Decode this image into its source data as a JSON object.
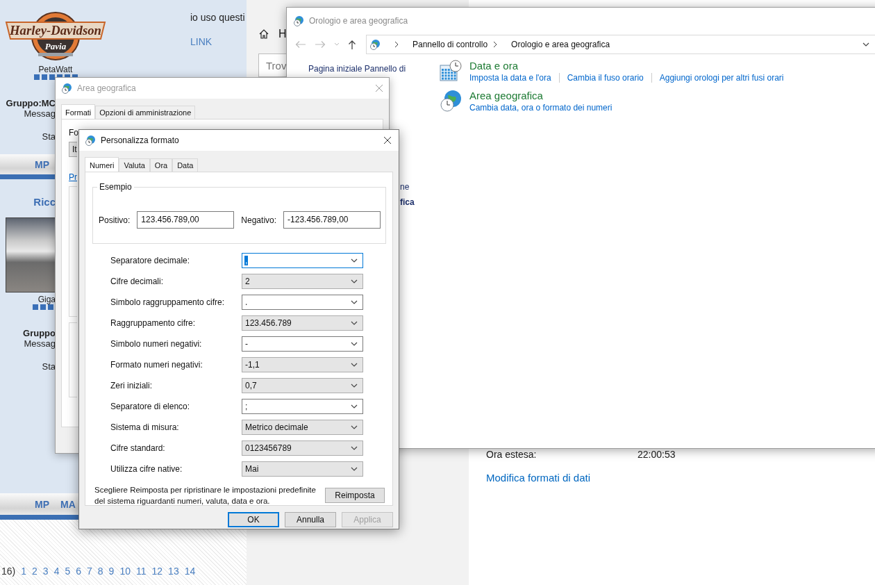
{
  "forum": {
    "posts": [
      {
        "avatar": {
          "kind": "logo",
          "line1": "Harley-Davidson",
          "line2": "Pavia"
        },
        "author": "PetaWatt",
        "group": "Gruppo:MC",
        "messages": "Messag",
        "status": "Sta",
        "body": "io uso questi",
        "link": "LINK",
        "bar_links": [
          "MP"
        ]
      },
      {
        "title": "Ricc",
        "avatar": {
          "kind": "photo"
        },
        "author": "Giga",
        "group": "Gruppo",
        "messages": "Messag",
        "status": "Sta",
        "bar_links": [
          "MP",
          "MA"
        ]
      }
    ],
    "pagination": {
      "count": "16)",
      "pages": [
        "1",
        "2",
        "3",
        "4",
        "5",
        "6",
        "7",
        "8",
        "9",
        "10",
        "11",
        "12",
        "13",
        "14"
      ]
    }
  },
  "settings": {
    "nav": {
      "home": "H",
      "search": {
        "placeholder": "Trov"
      }
    },
    "rows": [
      {
        "label": "Ora estesa:",
        "value": "22:00:53"
      }
    ],
    "link": "Modifica formati di dati"
  },
  "control_panel": {
    "title": "Orologio e area geografica",
    "address": [
      "Pannello di controllo",
      "Orologio e area geografica"
    ],
    "left_pane": {
      "home_link": "Pagina iniziale Pannello di",
      "fragments": [
        {
          "text": "ne",
          "bold": false
        },
        {
          "text": "fica",
          "bold": true
        }
      ]
    },
    "categories": [
      {
        "kind": "clock",
        "title": "Data e ora",
        "links": [
          "Imposta la data e l'ora",
          "Cambia il fuso orario",
          "Aggiungi orologi per altri fusi orari"
        ]
      },
      {
        "kind": "globe",
        "title": "Area geografica",
        "links": [
          "Cambia data, ora o formato dei numeri"
        ]
      }
    ]
  },
  "region_dialog": {
    "title": "Area geografica",
    "tabs": [
      {
        "label": "Formati",
        "selected": true
      },
      {
        "label": "Opzioni di amministrazione",
        "selected": false
      }
    ],
    "format_label": "Fo",
    "format_value": "It",
    "link": "Pr"
  },
  "format_dialog": {
    "title": "Personalizza formato",
    "tabs": [
      {
        "label": "Numeri",
        "selected": true
      },
      {
        "label": "Valuta",
        "selected": false
      },
      {
        "label": "Ora",
        "selected": false
      },
      {
        "label": "Data",
        "selected": false
      }
    ],
    "example": {
      "title": "Esempio",
      "fields": [
        {
          "label": "Positivo:",
          "value": "123.456.789,00"
        },
        {
          "label": "Negativo:",
          "value": "-123.456.789,00"
        }
      ]
    },
    "rows": [
      {
        "label": "Separatore decimale:",
        "value": ",",
        "kind": "editable",
        "focused": true
      },
      {
        "label": "Cifre decimali:",
        "value": "2",
        "kind": "dropdown",
        "focused": false
      },
      {
        "label": "Simbolo raggruppamento cifre:",
        "value": ".",
        "kind": "editable",
        "focused": false
      },
      {
        "label": "Raggruppamento cifre:",
        "value": "123.456.789",
        "kind": "dropdown",
        "focused": false
      },
      {
        "label": "Simbolo numeri negativi:",
        "value": "-",
        "kind": "editable",
        "focused": false
      },
      {
        "label": "Formato numeri negativi:",
        "value": "-1,1",
        "kind": "dropdown",
        "focused": false
      },
      {
        "label": "Zeri iniziali:",
        "value": "0,7",
        "kind": "dropdown",
        "focused": false
      },
      {
        "label": "Separatore di elenco:",
        "value": ";",
        "kind": "editable",
        "focused": false
      },
      {
        "label": "Sistema di misura:",
        "value": "Metrico decimale",
        "kind": "dropdown",
        "focused": false
      },
      {
        "label": "Cifre standard:",
        "value": "0123456789",
        "kind": "dropdown",
        "focused": false
      },
      {
        "label": "Utilizza cifre native:",
        "value": "Mai",
        "kind": "dropdown",
        "focused": false
      }
    ],
    "note": "Scegliere Reimposta per ripristinare le impostazioni predefinite del sistema riguardanti numeri, valuta, data e ora.",
    "reset_button": "Reimposta",
    "buttons": [
      {
        "label": "OK",
        "default": true,
        "disabled": false
      },
      {
        "label": "Annulla",
        "default": false,
        "disabled": false
      },
      {
        "label": "Applica",
        "default": false,
        "disabled": true
      }
    ]
  }
}
